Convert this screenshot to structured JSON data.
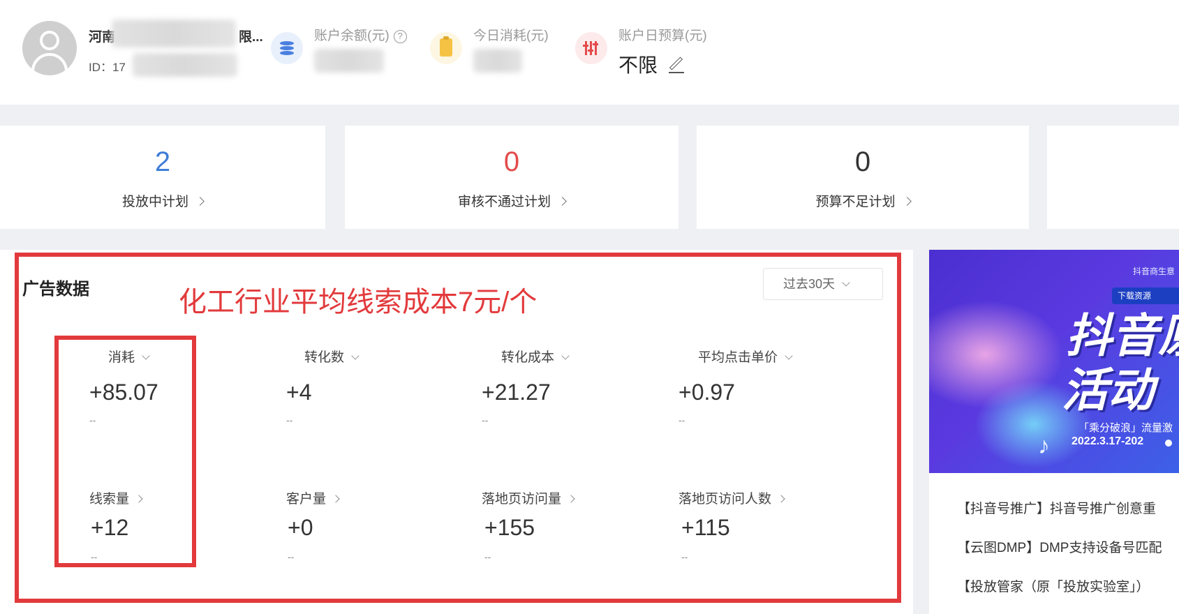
{
  "header": {
    "account_name_prefix": "河南",
    "account_name_suffix": "限...",
    "account_id_label": "ID：",
    "account_id_prefix": "17",
    "balance": {
      "label": "账户余额(元)",
      "help_icon": "question-circle-icon",
      "icon": "database-icon"
    },
    "today_spend": {
      "label": "今日消耗(元)",
      "icon": "clipboard-icon"
    },
    "daily_budget": {
      "label": "账户日预算(元)",
      "value": "不限",
      "icon": "sliders-icon",
      "edit_icon": "edit-icon"
    }
  },
  "stats": [
    {
      "value": "2",
      "label": "投放中计划",
      "color": "#3f7ed8"
    },
    {
      "value": "0",
      "label": "审核不通过计划",
      "color": "#e34b4b"
    },
    {
      "value": "0",
      "label": "预算不足计划",
      "color": "#333333"
    }
  ],
  "ad_data": {
    "title": "广告数据",
    "annotation": "化工行业平均线索成本7元/个",
    "range": "过去30天",
    "metrics": [
      {
        "label": "消耗",
        "value": "+85.07",
        "compare": "--"
      },
      {
        "label": "转化数",
        "value": "+4",
        "compare": "--"
      },
      {
        "label": "转化成本",
        "value": "+21.27",
        "compare": "--"
      },
      {
        "label": "平均点击单价",
        "value": "+0.97",
        "compare": "--"
      },
      {
        "label": "线索量",
        "value": "+12",
        "compare": "--"
      },
      {
        "label": "客户量",
        "value": "+0",
        "compare": "--"
      },
      {
        "label": "落地页访问量",
        "value": "+155",
        "compare": "--"
      },
      {
        "label": "落地页访问人数",
        "value": "+115",
        "compare": "--"
      }
    ]
  },
  "banner": {
    "brand": "抖音商生意",
    "pill": "下载资源",
    "headline_1": "抖音原",
    "headline_2": "活动",
    "subline": "「乘分破浪」流量激",
    "date": "2022.3.17-202"
  },
  "news": [
    "【抖音号推广】抖音号推广创意重",
    "【云图DMP】DMP支持设备号匹配",
    "【投放管家（原「投放实验室」）"
  ],
  "colors": {
    "accent_red": "#e23a3c",
    "blue": "#3f7ed8"
  }
}
